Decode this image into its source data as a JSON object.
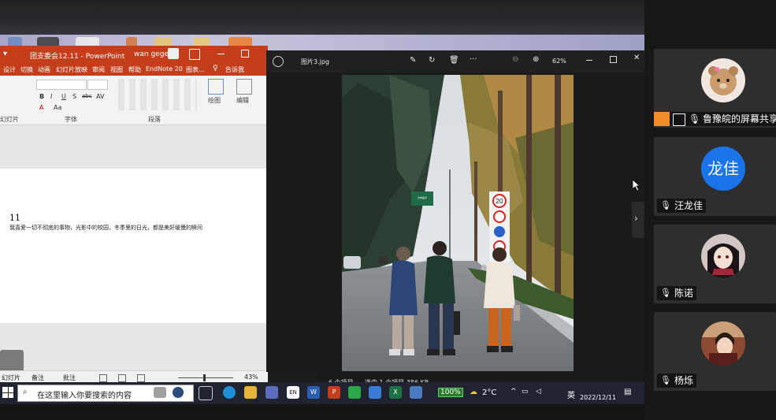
{
  "powerpoint": {
    "title": "团支委会12.11  -  PowerPoint",
    "user": "wan gege",
    "tabs": [
      "设计",
      "切换",
      "动画",
      "幻灯片放映",
      "审阅",
      "视图",
      "帮助",
      "EndNote 20",
      "图表…",
      "告诉我"
    ],
    "tell_me": "告诉我",
    "groups": {
      "font": "字体",
      "paragraph": "段落",
      "slides": "幻灯片"
    },
    "ribbon_buttons": {
      "draw": "绘图",
      "edit": "编辑"
    },
    "slide": {
      "number": "11",
      "text": "我喜爱一切不彻底的事物，光影中的校园，冬季里的日光，都是美好缓慢的瞬间"
    },
    "status": {
      "notes": "备注",
      "comments": "批注",
      "zoom": "43%",
      "left": "幻灯片"
    }
  },
  "photo_viewer": {
    "filename": "图片3.jpg",
    "zoom": "62%",
    "sign_text_1": "方向指示",
    "sign_text_2": "限速",
    "speed_sign": "20"
  },
  "explorer": {
    "items": "6 个项目",
    "selected": "选中 1 个项目  386 KB"
  },
  "taskbar": {
    "search_placeholder": "在这里输入你要搜索的内容",
    "battery": "100%",
    "temperature": "2°C",
    "ime": "英",
    "date": "2022/12/11"
  },
  "participants": [
    {
      "name": "鲁豫皖的屏幕共享",
      "avatar": "bear",
      "mic": "on",
      "sharing": true
    },
    {
      "name": "汪龙佳",
      "avatar_text": "龙佳",
      "avatar_color": "#1a73e8",
      "mic": "muted"
    },
    {
      "name": "陈诺",
      "avatar": "anime",
      "mic": "muted"
    },
    {
      "name": "杨烁",
      "avatar": "photo",
      "mic": "on"
    }
  ]
}
